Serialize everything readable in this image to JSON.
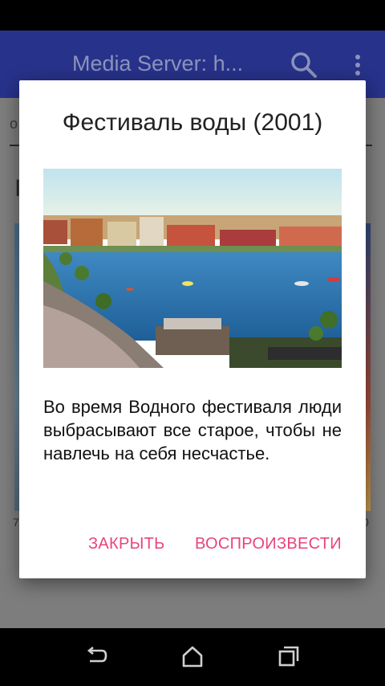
{
  "app_bar": {
    "title": "Media Server: h...",
    "search_icon": "search-icon",
    "menu_icon": "overflow-menu-icon",
    "background": "#27328a"
  },
  "background_content": {
    "tab_fragment": "о",
    "section_letter": "I",
    "left_fragment": "7",
    "right_fragment": "0"
  },
  "dialog": {
    "title": "Фестиваль воды (2001)",
    "image": "lakeside-festival-photo",
    "description": "Во время Водного фестиваля люди выбрасывают все старое, чтобы не навлечь на себя несчастье.",
    "close_label": "ЗАКРЫТЬ",
    "play_label": "ВОСПРОИЗВЕСТИ",
    "accent_color": "#e9447a"
  },
  "nav_bar": {
    "back_icon": "back-icon",
    "home_icon": "home-icon",
    "recents_icon": "recents-icon"
  }
}
